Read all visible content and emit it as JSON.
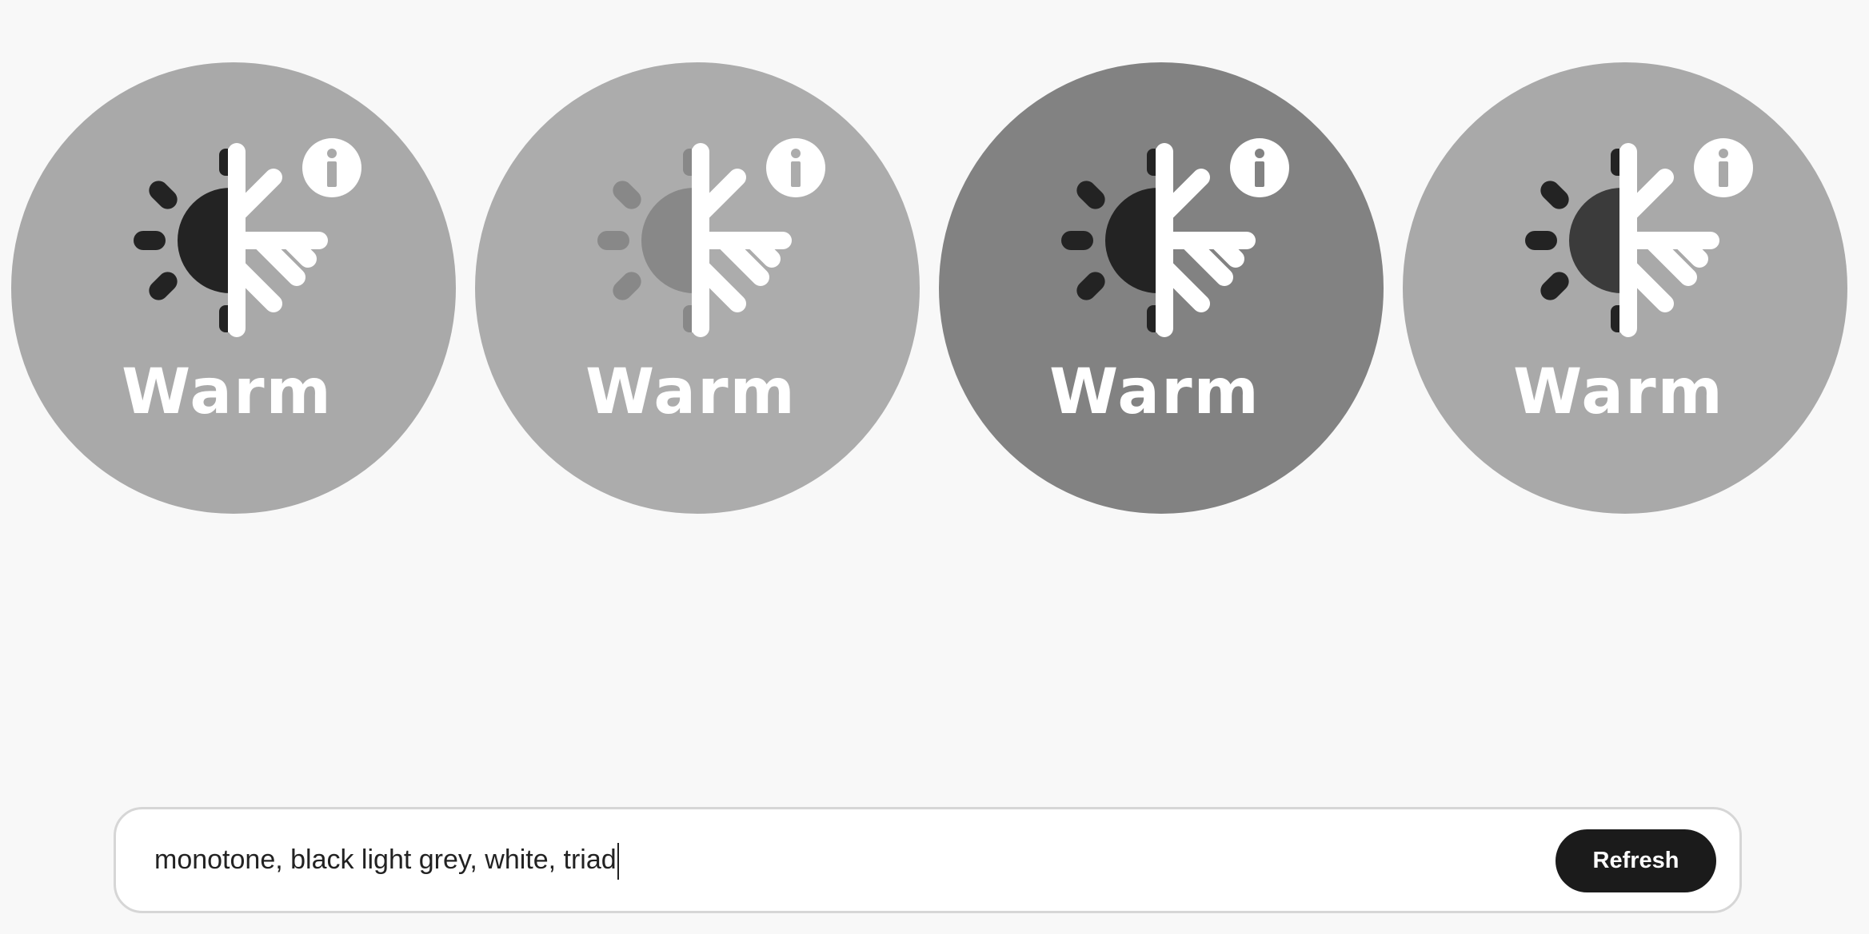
{
  "cards": [
    {
      "label": "Warm",
      "icon": "warm-cool-icon",
      "info_icon": "info-icon",
      "colors": {
        "background": "#a9a9a9",
        "sun": "#232323",
        "rays": "#232323",
        "snow": "#ffffff"
      }
    },
    {
      "label": "Warm",
      "icon": "warm-cool-icon",
      "info_icon": "info-icon",
      "colors": {
        "background": "#acacac",
        "sun": "#888888",
        "rays": "#888888",
        "snow": "#ffffff"
      }
    },
    {
      "label": "Warm",
      "icon": "warm-cool-icon",
      "info_icon": "info-icon",
      "colors": {
        "background": "#828282",
        "sun": "#232323",
        "rays": "#232323",
        "snow": "#ffffff"
      }
    },
    {
      "label": "Warm",
      "icon": "warm-cool-icon",
      "info_icon": "info-icon",
      "colors": {
        "background": "#a9a9a9",
        "sun": "#3b3b3b",
        "rays": "#232323",
        "snow": "#ffffff"
      }
    }
  ],
  "prompt": {
    "value": "monotone, black light grey, white, triad",
    "refresh_label": "Refresh"
  },
  "colors": {
    "page_background": "#f8f8f8",
    "input_border": "#d6d6d6",
    "button_background": "#1b1b1b"
  }
}
